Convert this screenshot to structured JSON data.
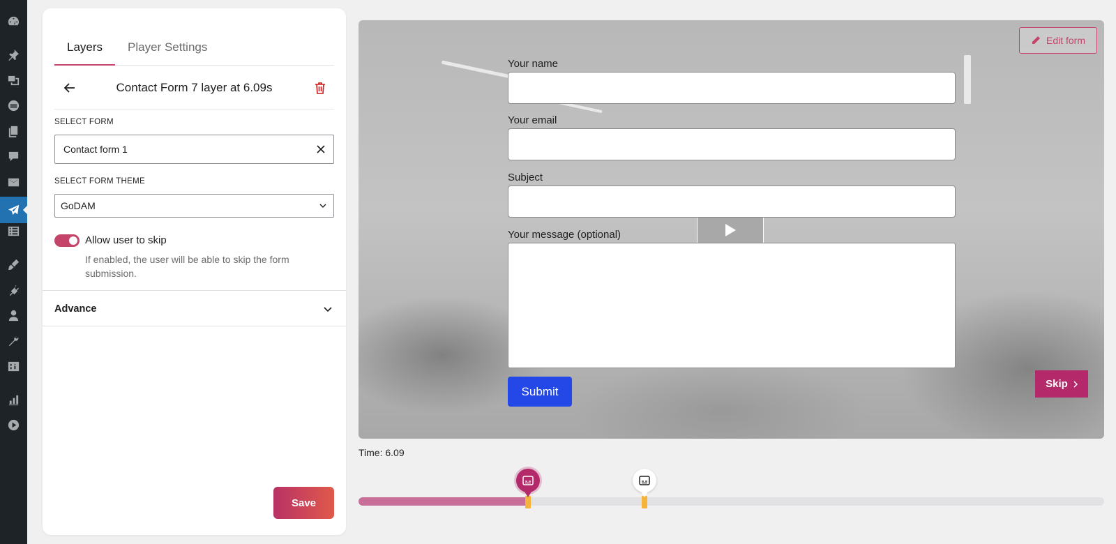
{
  "wp_menu": {
    "icons": [
      "dashboard-icon",
      "pin-icon",
      "media-icon",
      "stream-icon",
      "pages-icon",
      "comments-icon",
      "mail-icon",
      "godam-icon",
      "forms-icon",
      "appearance-icon",
      "plugins-icon",
      "users-icon",
      "tools-icon",
      "settings-icon",
      "analytics-icon",
      "video-play-icon"
    ],
    "active": "godam-icon"
  },
  "panel": {
    "tabs": [
      {
        "label": "Layers",
        "active": true
      },
      {
        "label": "Player Settings",
        "active": false
      }
    ],
    "layer_title": "Contact Form 7 layer at 6.09s",
    "select_form": {
      "label": "SELECT FORM",
      "value": "Contact form 1"
    },
    "select_theme": {
      "label": "SELECT FORM THEME",
      "value": "GoDAM"
    },
    "skip_toggle": {
      "label": "Allow user to skip",
      "enabled": true,
      "help": "If enabled, the user will be able to skip the form submission."
    },
    "advance_label": "Advance",
    "save_label": "Save"
  },
  "video": {
    "edit_form_label": "Edit form",
    "form": {
      "fields": [
        {
          "label": "Your name",
          "value": ""
        },
        {
          "label": "Your email",
          "value": ""
        },
        {
          "label": "Subject",
          "value": ""
        }
      ],
      "message_label": "Your message (optional)",
      "message_value": "",
      "submit_label": "Submit"
    },
    "skip_label": "Skip"
  },
  "timeline": {
    "time_text": "Time: 6.09",
    "progress": 0.227,
    "markers": [
      {
        "position": 0.227,
        "active": true,
        "icon": "subtitles-icon"
      },
      {
        "position": 0.384,
        "active": false,
        "icon": "subtitles-icon"
      }
    ]
  },
  "colors": {
    "accent": "#c44569",
    "skip": "#b3296a",
    "submit": "#2448e8",
    "marker_stem": "#f5b33a",
    "wp_sidebar": "#1d2327"
  }
}
